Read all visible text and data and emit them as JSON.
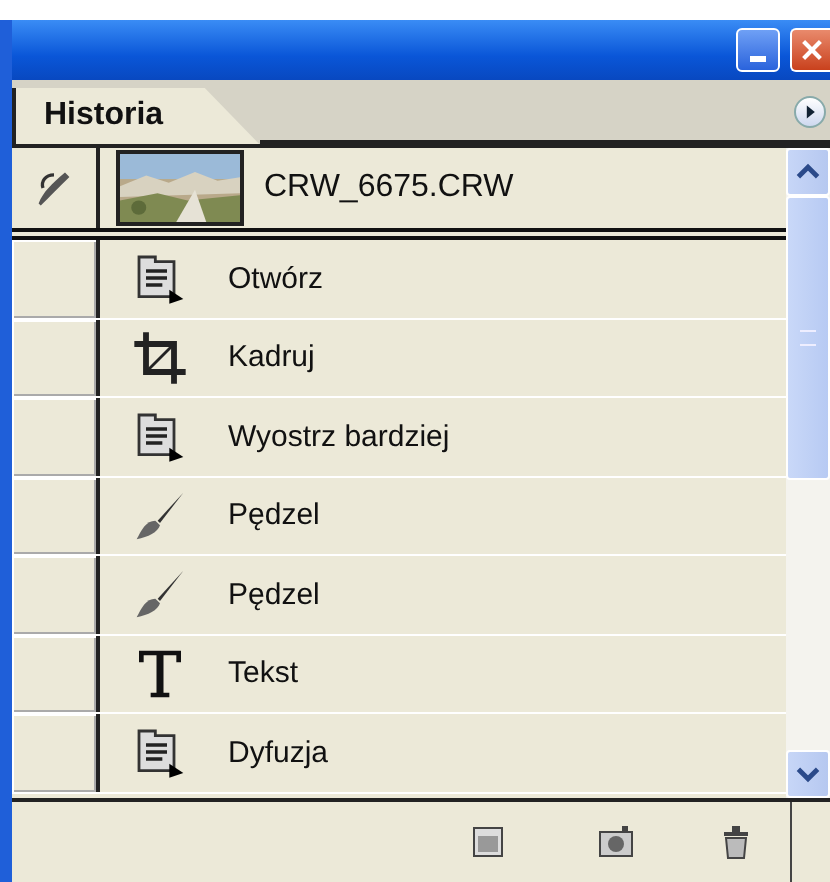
{
  "panel": {
    "tab": {
      "label": "Historia",
      "selected": true
    }
  },
  "snapshot": {
    "name": "CRW_6675.CRW",
    "history_source": true
  },
  "history": [
    {
      "kind": "document",
      "label": "Otwórz",
      "history_source": false
    },
    {
      "kind": "crop",
      "label": "Kadruj",
      "history_source": false
    },
    {
      "kind": "document",
      "label": "Wyostrz bardziej",
      "history_source": false
    },
    {
      "kind": "brush",
      "label": "Pędzel",
      "history_source": false
    },
    {
      "kind": "brush",
      "label": "Pędzel",
      "history_source": false
    },
    {
      "kind": "text",
      "label": "Tekst",
      "history_source": false
    },
    {
      "kind": "document",
      "label": "Dyfuzja",
      "history_source": false
    }
  ]
}
